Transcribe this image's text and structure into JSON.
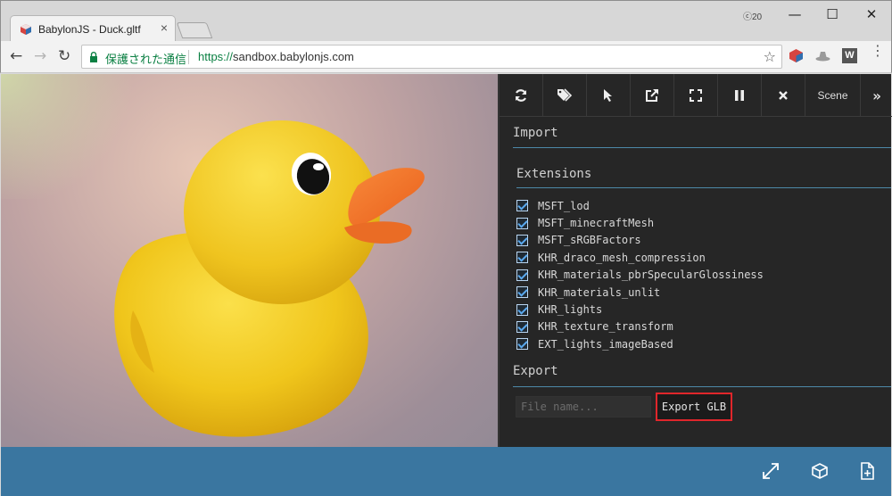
{
  "browser": {
    "tab_title": "BabylonJS - Duck.gltf",
    "tab_close": "×",
    "profile_badge": "ⓒ20",
    "window_controls": {
      "minimize": "—",
      "maximize": "☐",
      "close": "✕"
    },
    "nav": {
      "back": "←",
      "forward": "→",
      "reload": "↻"
    },
    "security_label": "保護された通信",
    "url_scheme": "https://",
    "url_rest": "sandbox.babylonjs.com",
    "bookmark_star": "☆",
    "extension_w_label": "W",
    "menu": "⋮"
  },
  "inspector": {
    "toolbar_icons": [
      "refresh-icon",
      "tags-icon",
      "pointer-icon",
      "popout-icon",
      "fullscreen-icon",
      "pause-icon",
      "close-icon"
    ],
    "scene_tab": "Scene",
    "more": "»",
    "import_title": "Import",
    "extensions_title": "Extensions",
    "extensions": [
      {
        "label": "MSFT_lod",
        "checked": true
      },
      {
        "label": "MSFT_minecraftMesh",
        "checked": true
      },
      {
        "label": "MSFT_sRGBFactors",
        "checked": true
      },
      {
        "label": "KHR_draco_mesh_compression",
        "checked": true
      },
      {
        "label": "KHR_materials_pbrSpecularGlossiness",
        "checked": true
      },
      {
        "label": "KHR_materials_unlit",
        "checked": true
      },
      {
        "label": "KHR_lights",
        "checked": true
      },
      {
        "label": "KHR_texture_transform",
        "checked": true
      },
      {
        "label": "EXT_lights_imageBased",
        "checked": true
      }
    ],
    "export_title": "Export",
    "file_name_placeholder": "File name...",
    "export_button": "Export GLB"
  },
  "footer": {
    "icons": [
      "fullscreen-expand-icon",
      "inspector-cube-icon",
      "open-file-icon"
    ],
    "background": "#3a76a0"
  },
  "colors": {
    "accent_line": "#4d89a8",
    "highlight_border": "#e0262b",
    "inspector_bg": "#262626"
  }
}
